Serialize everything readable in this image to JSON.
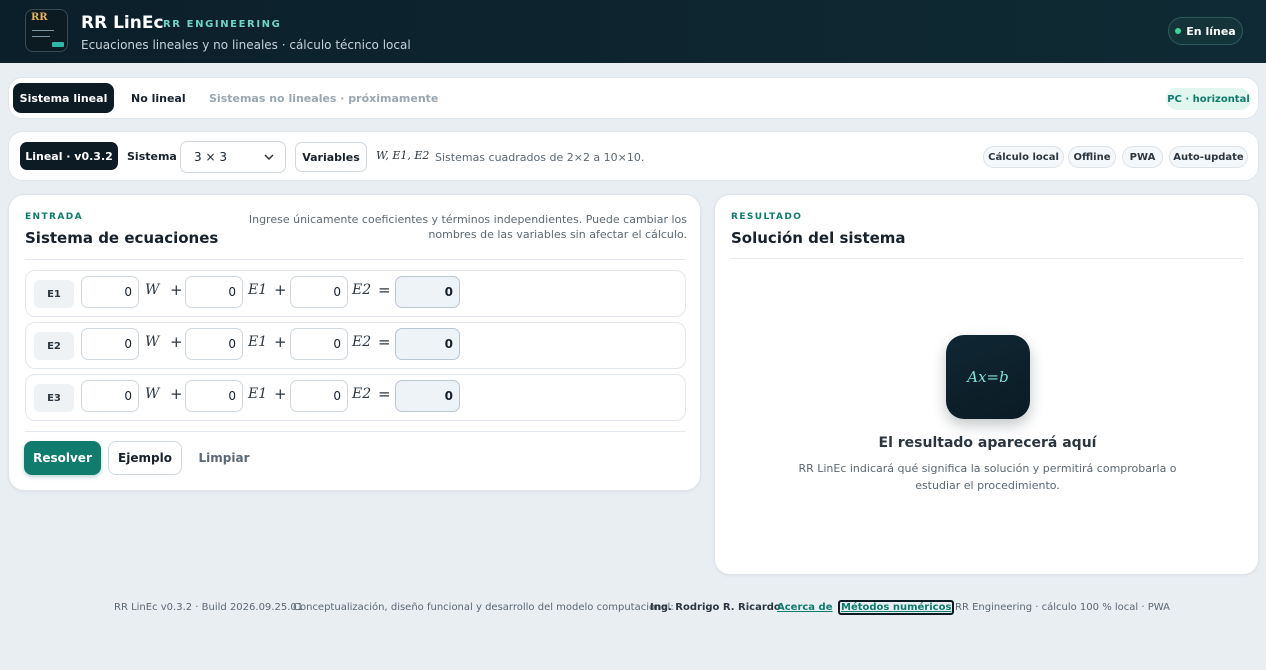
{
  "header": {
    "logo_text": "RR",
    "title": "RR LinEc",
    "brand": "RR ENGINEERING",
    "subtitle": "Ecuaciones lineales y no lineales · cálculo técnico local",
    "status": "En línea"
  },
  "tabs": {
    "items": [
      "Sistema lineal",
      "No lineal",
      "Sistemas no lineales · próximamente"
    ],
    "active": "Sistema lineal",
    "device_badge": "PC · horizontal"
  },
  "toolbar": {
    "version_badge": "Lineal · v0.3.2",
    "system_label": "Sistema",
    "system_value": "3 × 3",
    "variables_button": "Variables",
    "variables_list": "W, E1, E2",
    "sizes_note": "Sistemas cuadrados de 2×2 a 10×10.",
    "pills": [
      "Cálculo local",
      "Offline",
      "PWA",
      "Auto-update"
    ]
  },
  "input_panel": {
    "eyebrow": "ENTRADA",
    "title": "Sistema de ecuaciones",
    "hint": "Ingrese únicamente coeficientes y términos independientes. Puede cambiar los nombres de las variables sin afectar el cálculo.",
    "variables": [
      "W",
      "E1",
      "E2"
    ],
    "plus": "+",
    "equals": "=",
    "equations": [
      {
        "label": "E1",
        "coefficients": [
          "0",
          "0",
          "0"
        ],
        "rhs": "0"
      },
      {
        "label": "E2",
        "coefficients": [
          "0",
          "0",
          "0"
        ],
        "rhs": "0"
      },
      {
        "label": "E3",
        "coefficients": [
          "0",
          "0",
          "0"
        ],
        "rhs": "0"
      }
    ],
    "buttons": {
      "solve": "Resolver",
      "example": "Ejemplo",
      "clear": "Limpiar"
    }
  },
  "result_panel": {
    "eyebrow": "RESULTADO",
    "title": "Solución del sistema",
    "icon_text": "Ax=b",
    "empty_title": "El resultado aparecerá aquí",
    "empty_description": "RR LinEc indicará qué significa la solución y permitirá comprobarla o estudiar el procedimiento."
  },
  "footer": {
    "build": "RR LinEc v0.3.2 · Build 2026.09.25.01",
    "credit": "Conceptualización, diseño funcional y desarrollo del modelo computacional:",
    "author": "Ing. Rodrigo R. Ricardo",
    "about_link": "Acerca de",
    "methods_link": "Métodos numéricos",
    "tagline": "RR Engineering · cálculo 100 % local · PWA"
  },
  "colors": {
    "header_bg": "#0b1f2a",
    "accent": "#0f7c6e",
    "brand_text": "#6fd6c4",
    "status_dot": "#3ad59a"
  }
}
